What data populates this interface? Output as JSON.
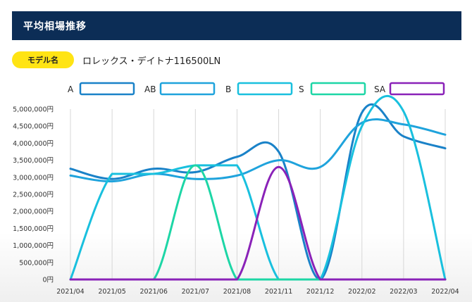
{
  "header": {
    "title": "平均相場推移"
  },
  "model": {
    "badge_label": "モデル名",
    "name": "ロレックス・デイトナ116500LN"
  },
  "chart_data": {
    "type": "line",
    "categories": [
      "2021/04",
      "2021/05",
      "2021/06",
      "2021/07",
      "2021/08",
      "2021/11",
      "2021/12",
      "2022/02",
      "2022/03",
      "2022/04"
    ],
    "y_ticks": [
      "0円",
      "500,000円",
      "1,000,000円",
      "1,500,000円",
      "2,000,000円",
      "2,500,000円",
      "3,000,000円",
      "3,500,000円",
      "4,000,000円",
      "4,500,000円",
      "5,000,000円"
    ],
    "ylim": [
      0,
      5000000
    ],
    "grid": "vertical",
    "legend_position": "top",
    "series": [
      {
        "name": "A",
        "color": "#1a82c8",
        "values": [
          3250000,
          2950000,
          3250000,
          3150000,
          3600000,
          3750000,
          0,
          4900000,
          4200000,
          3850000
        ]
      },
      {
        "name": "AB",
        "color": "#1fa3dc",
        "values": [
          3050000,
          2880000,
          3100000,
          2950000,
          3050000,
          3500000,
          3300000,
          4600000,
          4550000,
          4250000
        ]
      },
      {
        "name": "B",
        "color": "#19c0de",
        "values": [
          0,
          3100000,
          3100000,
          3350000,
          3350000,
          0,
          0,
          4500000,
          4930000,
          0
        ]
      },
      {
        "name": "S",
        "color": "#1dd6a6",
        "values": [
          0,
          0,
          0,
          3350000,
          0,
          0,
          0,
          0,
          0,
          0
        ]
      },
      {
        "name": "SA",
        "color": "#8a22b8",
        "values": [
          0,
          0,
          0,
          0,
          0,
          3300000,
          0,
          0,
          0,
          0
        ]
      }
    ]
  }
}
